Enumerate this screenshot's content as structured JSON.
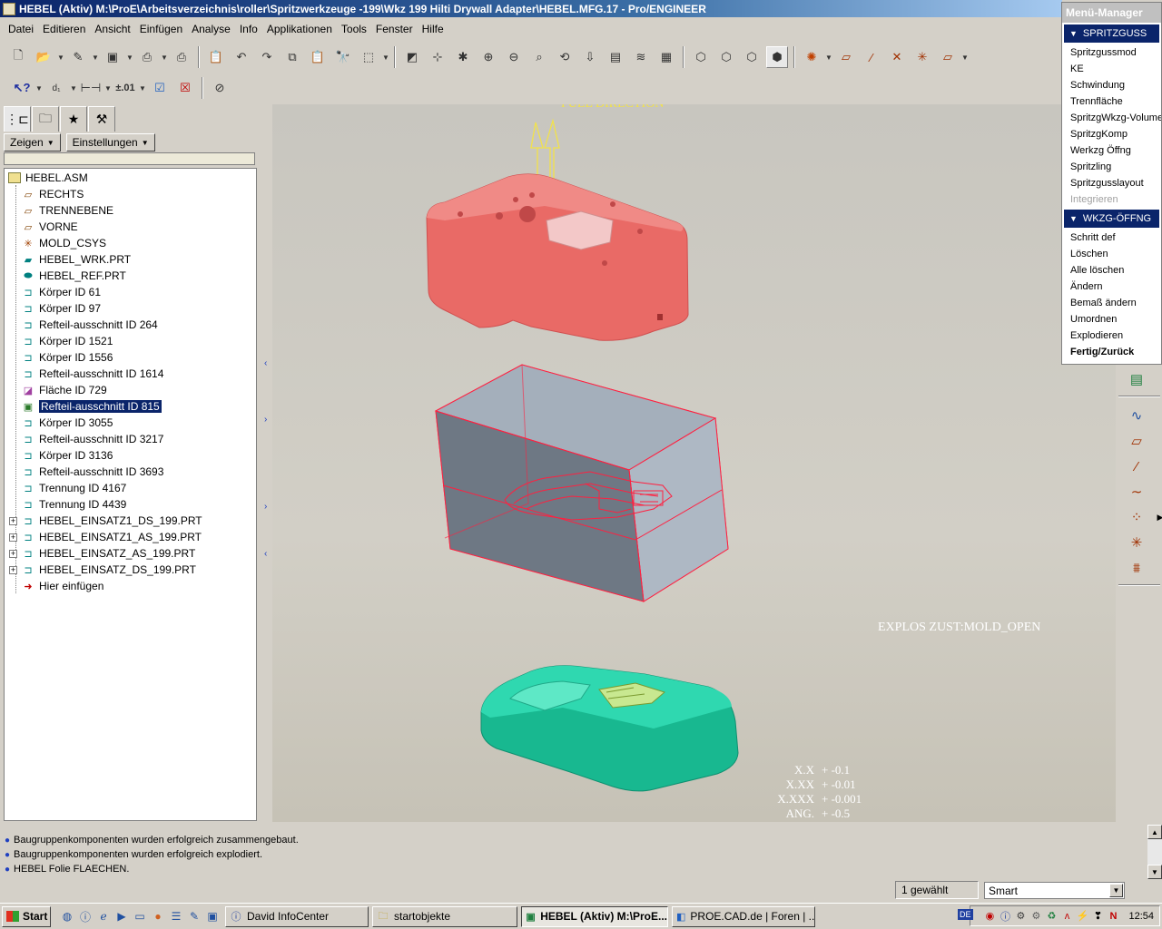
{
  "window": {
    "title": "HEBEL (Aktiv) M:\\ProE\\Arbeitsverzeichnis\\roller\\Spritzwerkzeuge -199\\Wkz 199 Hilti Drywall Adapter\\HEBEL.MFG.17 - Pro/ENGINEER"
  },
  "menubar": {
    "items": [
      "Datei",
      "Editieren",
      "Ansicht",
      "Einfügen",
      "Analyse",
      "Info",
      "Applikationen",
      "Tools",
      "Fenster",
      "Hilfe"
    ]
  },
  "left_panel": {
    "show_button": "Zeigen",
    "settings_button": "Einstellungen",
    "tree": {
      "root": "HEBEL.ASM",
      "items": [
        {
          "label": "RECHTS",
          "icon": "datum-plane-icon"
        },
        {
          "label": "TRENNEBENE",
          "icon": "datum-plane-icon"
        },
        {
          "label": "VORNE",
          "icon": "datum-plane-icon"
        },
        {
          "label": "MOLD_CSYS",
          "icon": "csys-icon"
        },
        {
          "label": "HEBEL_WRK.PRT",
          "icon": "workpiece-icon"
        },
        {
          "label": "HEBEL_REF.PRT",
          "icon": "reference-part-icon"
        },
        {
          "label": "Körper ID 61",
          "icon": "body-icon"
        },
        {
          "label": "Körper ID 97",
          "icon": "body-icon"
        },
        {
          "label": "Refteil-ausschnitt ID 264",
          "icon": "body-icon"
        },
        {
          "label": "Körper ID 1521",
          "icon": "body-icon"
        },
        {
          "label": "Körper ID 1556",
          "icon": "body-icon"
        },
        {
          "label": "Refteil-ausschnitt ID 1614",
          "icon": "body-icon"
        },
        {
          "label": "Fläche ID 729",
          "icon": "surface-icon"
        },
        {
          "label": "Refteil-ausschnitt ID 815",
          "icon": "cutout-icon",
          "selected": true
        },
        {
          "label": "Körper ID 3055",
          "icon": "body-icon"
        },
        {
          "label": "Refteil-ausschnitt ID 3217",
          "icon": "body-icon"
        },
        {
          "label": "Körper ID 3136",
          "icon": "body-icon"
        },
        {
          "label": "Refteil-ausschnitt ID 3693",
          "icon": "body-icon"
        },
        {
          "label": "Trennung ID 4167",
          "icon": "body-icon"
        },
        {
          "label": "Trennung ID 4439",
          "icon": "body-icon"
        }
      ],
      "expandable": [
        "HEBEL_EINSATZ1_DS_199.PRT",
        "HEBEL_EINSATZ1_AS_199.PRT",
        "HEBEL_EINSATZ_AS_199.PRT",
        "HEBEL_EINSATZ_DS_199.PRT"
      ],
      "insert_here": "Hier einfügen"
    }
  },
  "graphics": {
    "pull_direction": "PULL DIRECTION",
    "explode_state": "EXPLOS ZUST:MOLD_OPEN",
    "tolerances": [
      {
        "key": "X.X",
        "value": "+ -0.1"
      },
      {
        "key": "X.XX",
        "value": "+ -0.01"
      },
      {
        "key": "X.XXX",
        "value": "+ -0.001"
      },
      {
        "key": "ANG.",
        "value": "+ -0.5"
      }
    ],
    "colors": {
      "upper_plate": "#e86060",
      "lower_plate": "#20c8a0",
      "workpiece_edges": "#ff2040"
    }
  },
  "menu_manager": {
    "title": "Menü-Manager",
    "section1": "SPRITZGUSS",
    "items1": [
      "Spritzgussmod",
      "KE",
      "Schwindung",
      "Trennfläche",
      "SpritzgWkzg-Volumen",
      "SpritzgKomp",
      "Werkzg Öffng",
      "Spritzling",
      "Spritzgusslayout"
    ],
    "disabled1": "Integrieren",
    "section2": "WKZG-ÖFFNG",
    "items2": [
      "Schritt def",
      "Löschen",
      "Alle löschen",
      "Ändern",
      "Bemaß ändern",
      "Umordnen",
      "Explodieren"
    ],
    "done": "Fertig/Zurück"
  },
  "messages": [
    "Baugruppenkomponenten wurden erfolgreich zusammengebaut.",
    "Baugruppenkomponenten wurden erfolgreich explodiert.",
    "HEBEL Folie FLAECHEN."
  ],
  "statusbar": {
    "selected_count": "1 gewählt",
    "filter": "Smart"
  },
  "taskbar": {
    "start": "Start",
    "tasks": [
      {
        "label": "David InfoCenter"
      },
      {
        "label": "startobjekte"
      },
      {
        "label": "HEBEL (Aktiv) M:\\ProE...",
        "active": true
      },
      {
        "label": "PROE.CAD.de | Foren | ..."
      }
    ],
    "language": "DE",
    "clock": "12:54"
  }
}
